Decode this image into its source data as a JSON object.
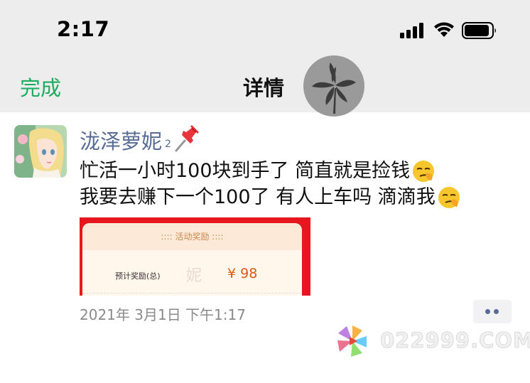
{
  "status_bar": {
    "time": "2:17",
    "icons": [
      "signal-icon",
      "wifi-icon",
      "battery-icon"
    ]
  },
  "nav": {
    "done_label": "完成",
    "title": "详情",
    "done_color": "#1aad5f"
  },
  "post": {
    "username": "泷泽萝妮",
    "user_level": "2",
    "pin_emoji": "pushpin",
    "text_lines": [
      {
        "text": "忙活一小时100块到手了 简直就是捡钱",
        "emoji": "smirk-emoji"
      },
      {
        "text": "我要去赚下一个100了 有人上车吗 滴滴我",
        "emoji": "smirk-emoji"
      }
    ],
    "image": {
      "header": ":::: 活动奖励 ::::",
      "label": "预计奖励(总)",
      "watermark_char": "妮",
      "amount": "¥ 98"
    },
    "timestamp": "2021年 3月1日 下午1:17",
    "name_color": "#576b95"
  },
  "watermark": {
    "text": "022999.COM",
    "logo": "pinwheel-logo"
  }
}
